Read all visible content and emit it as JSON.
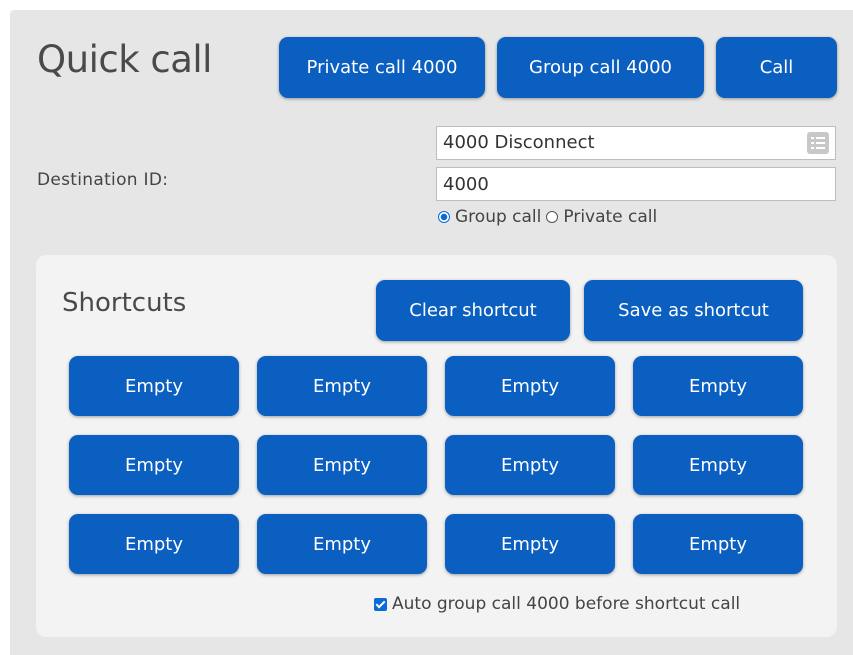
{
  "quick_call": {
    "title": "Quick call",
    "buttons": {
      "private_call": "Private call 4000",
      "group_call": "Group call 4000",
      "call": "Call"
    },
    "destination_label": "Destination ID:",
    "contact_select_value": "4000 Disconnect",
    "destination_input_value": "4000",
    "call_type": {
      "options": [
        "Group call",
        "Private call"
      ],
      "selected": "Group call"
    }
  },
  "shortcuts": {
    "title": "Shortcuts",
    "clear_label": "Clear shortcut",
    "save_label": "Save as shortcut",
    "slots": [
      "Empty",
      "Empty",
      "Empty",
      "Empty",
      "Empty",
      "Empty",
      "Empty",
      "Empty",
      "Empty",
      "Empty",
      "Empty",
      "Empty"
    ],
    "auto_group_call_label": "Auto group call 4000 before shortcut call",
    "auto_group_call_checked": true
  },
  "colors": {
    "button": "#0a5fc0",
    "panel": "#e6e6e6",
    "shortcuts_panel": "#f3f3f3"
  },
  "icons": [
    "list-icon",
    "radio-icon",
    "checkbox-icon"
  ]
}
